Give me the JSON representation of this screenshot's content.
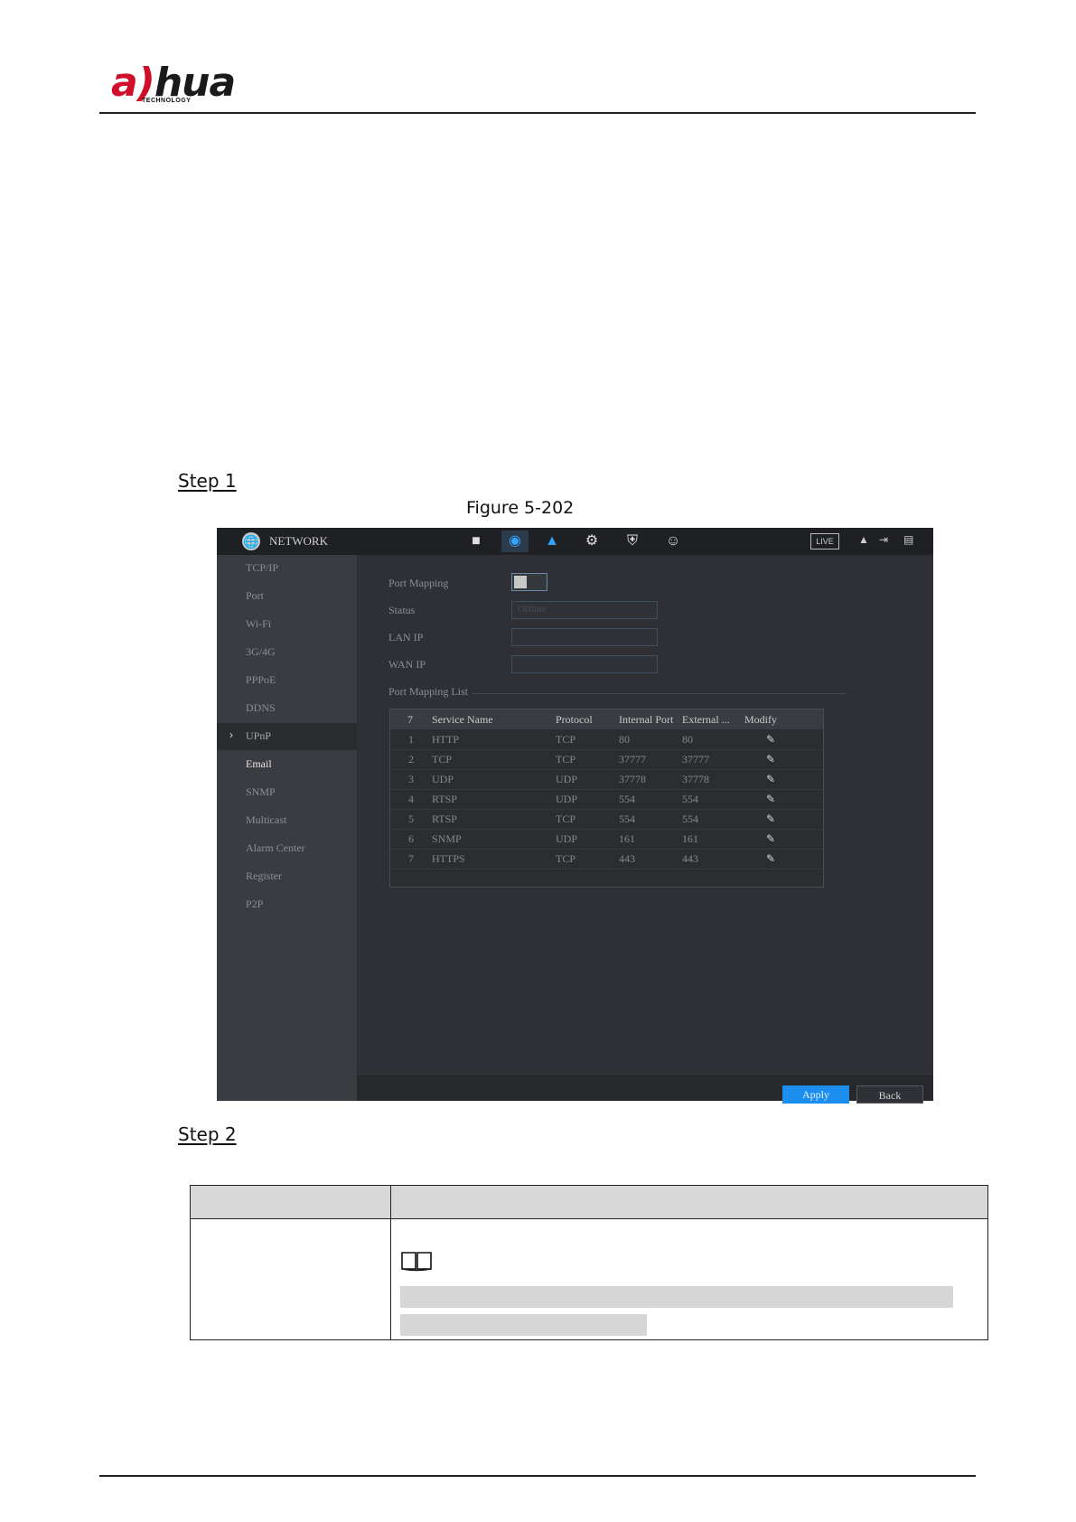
{
  "header": {
    "logo_text_a": "a",
    "logo_text_hua": "hua",
    "logo_sub": "TECHNOLOGY"
  },
  "steps": {
    "step1": "Step 1",
    "step2": "Step 2"
  },
  "figure": {
    "caption": "Figure 5-202"
  },
  "screenshot": {
    "title": "NETWORK",
    "toolbar_icons": [
      "camera-icon",
      "network-icon",
      "storage-icon",
      "system-gear-icon",
      "security-shield-icon",
      "account-icon"
    ],
    "live_label": "LIVE",
    "sidebar_items": [
      "TCP/IP",
      "Port",
      "Wi-Fi",
      "3G/4G",
      "PPPoE",
      "DDNS",
      "UPnP",
      "Email",
      "SNMP",
      "Multicast",
      "Alarm Center",
      "Register",
      "P2P"
    ],
    "selected_item": "UPnP",
    "fields": {
      "port_mapping_label": "Port Mapping",
      "status_label": "Status",
      "status_value": "Offline",
      "lan_ip_label": "LAN IP",
      "wan_ip_label": "WAN IP",
      "list_title": "Port Mapping List"
    },
    "table": {
      "headers": [
        "7",
        "Service Name",
        "Protocol",
        "Internal Port",
        "External ...",
        "Modify"
      ],
      "rows": [
        {
          "idx": "1",
          "name": "HTTP",
          "protocol": "TCP",
          "internal": "80",
          "external": "80"
        },
        {
          "idx": "2",
          "name": "TCP",
          "protocol": "TCP",
          "internal": "37777",
          "external": "37777"
        },
        {
          "idx": "3",
          "name": "UDP",
          "protocol": "UDP",
          "internal": "37778",
          "external": "37778"
        },
        {
          "idx": "4",
          "name": "RTSP",
          "protocol": "UDP",
          "internal": "554",
          "external": "554"
        },
        {
          "idx": "5",
          "name": "RTSP",
          "protocol": "TCP",
          "internal": "554",
          "external": "554"
        },
        {
          "idx": "6",
          "name": "SNMP",
          "protocol": "UDP",
          "internal": "161",
          "external": "161"
        },
        {
          "idx": "7",
          "name": "HTTPS",
          "protocol": "TCP",
          "internal": "443",
          "external": "443"
        }
      ]
    },
    "buttons": {
      "apply": "Apply",
      "back": "Back"
    }
  },
  "colors": {
    "brand_red": "#d0102a",
    "accent_blue": "#1b8ef0"
  }
}
